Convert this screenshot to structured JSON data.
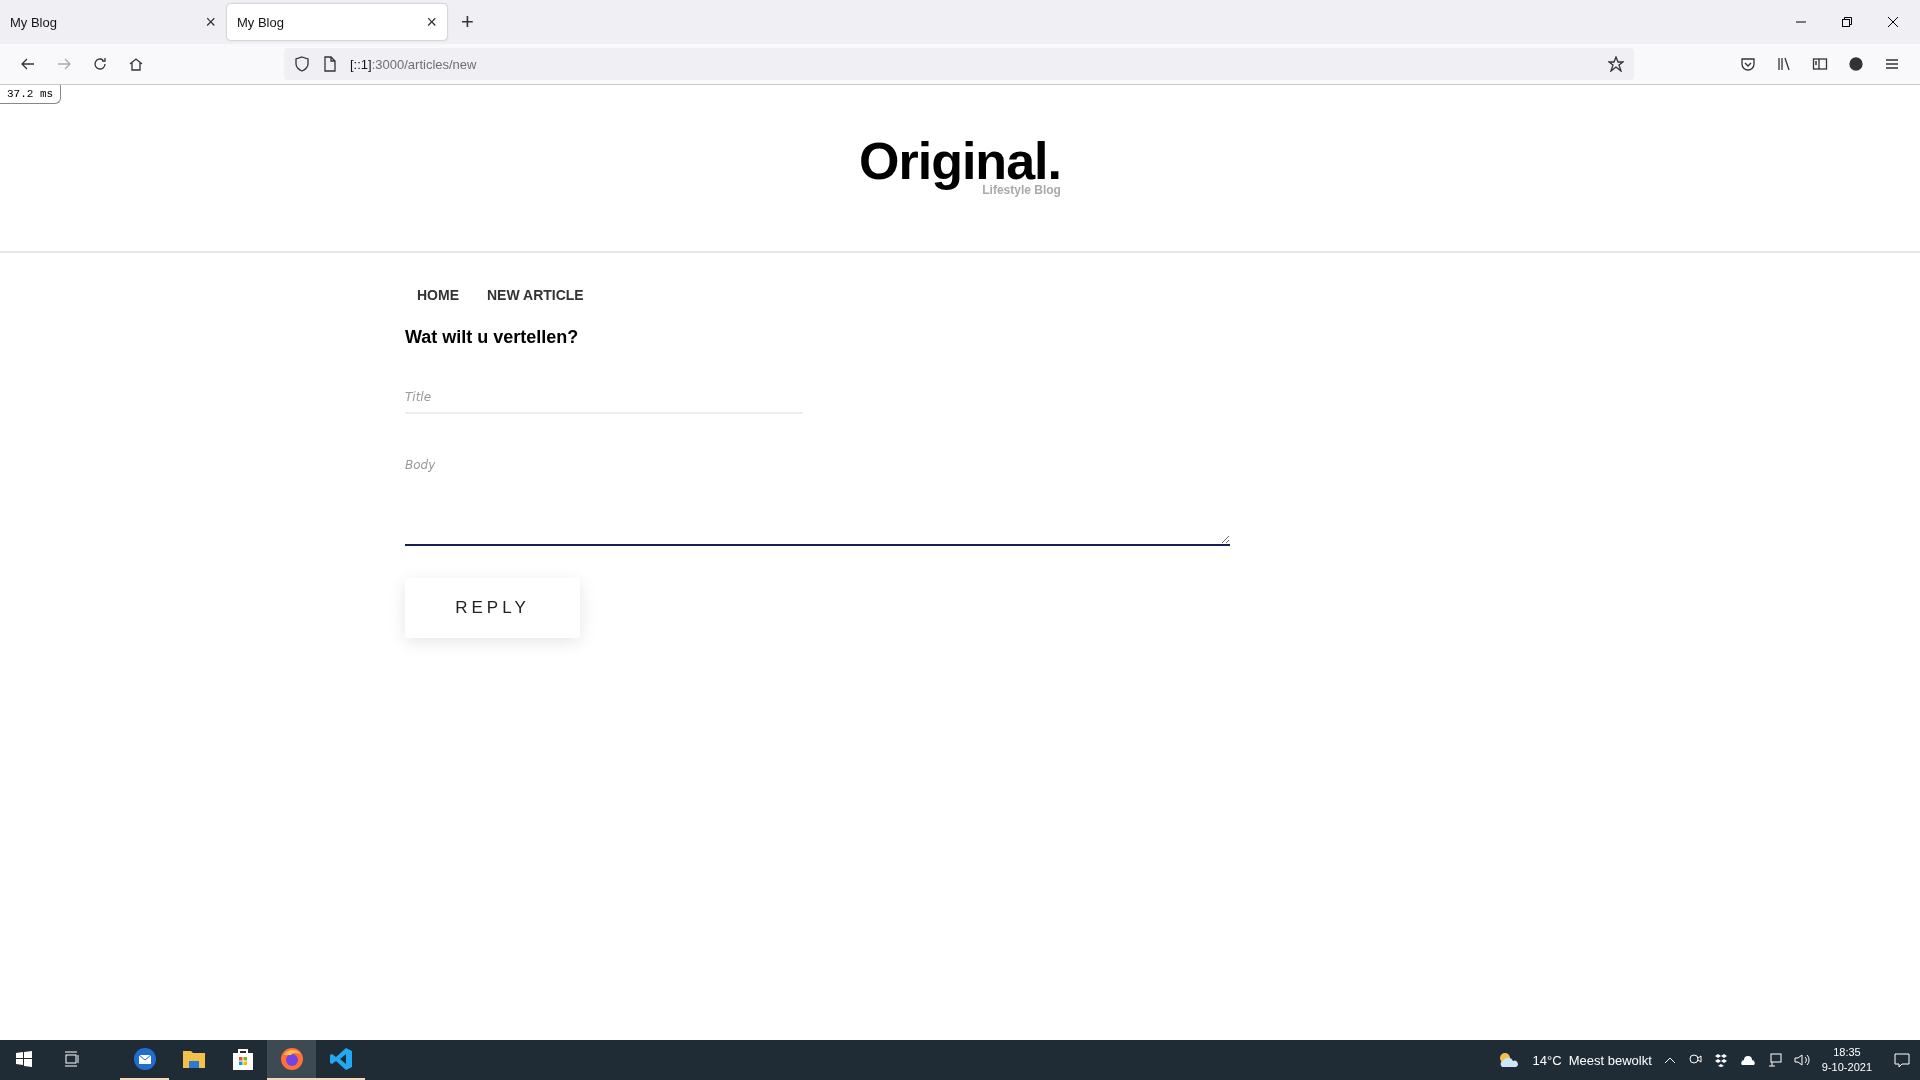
{
  "browser": {
    "tabs": [
      {
        "title": "My Blog",
        "close": "×",
        "selected": false
      },
      {
        "title": "My Blog",
        "close": "×",
        "selected": true
      }
    ],
    "new_tab": "+",
    "url": {
      "host": "[::1]",
      "path": ":3000/articles/new"
    }
  },
  "timing_badge": "37.2 ms",
  "site": {
    "logo": "Original.",
    "tagline": "Lifestyle Blog"
  },
  "nav": [
    "HOME",
    "NEW ARTICLE"
  ],
  "form": {
    "heading": "Wat wilt u vertellen?",
    "title": {
      "placeholder": "Title"
    },
    "body": {
      "placeholder": "Body"
    },
    "submit": "REPLY"
  },
  "taskbar": {
    "apps": [
      {
        "kind": "start",
        "open": false,
        "active": false
      },
      {
        "kind": "taskview",
        "open": false,
        "active": false
      },
      {
        "kind": "mail",
        "open": true,
        "active": false
      },
      {
        "kind": "folder",
        "open": false,
        "active": false
      },
      {
        "kind": "store",
        "open": false,
        "active": false
      },
      {
        "kind": "firefox",
        "open": true,
        "active": true
      },
      {
        "kind": "code",
        "open": true,
        "active": false
      }
    ],
    "weather": "14°C  Meest bewolkt",
    "time": "18:35",
    "date": "9-10-2021"
  }
}
